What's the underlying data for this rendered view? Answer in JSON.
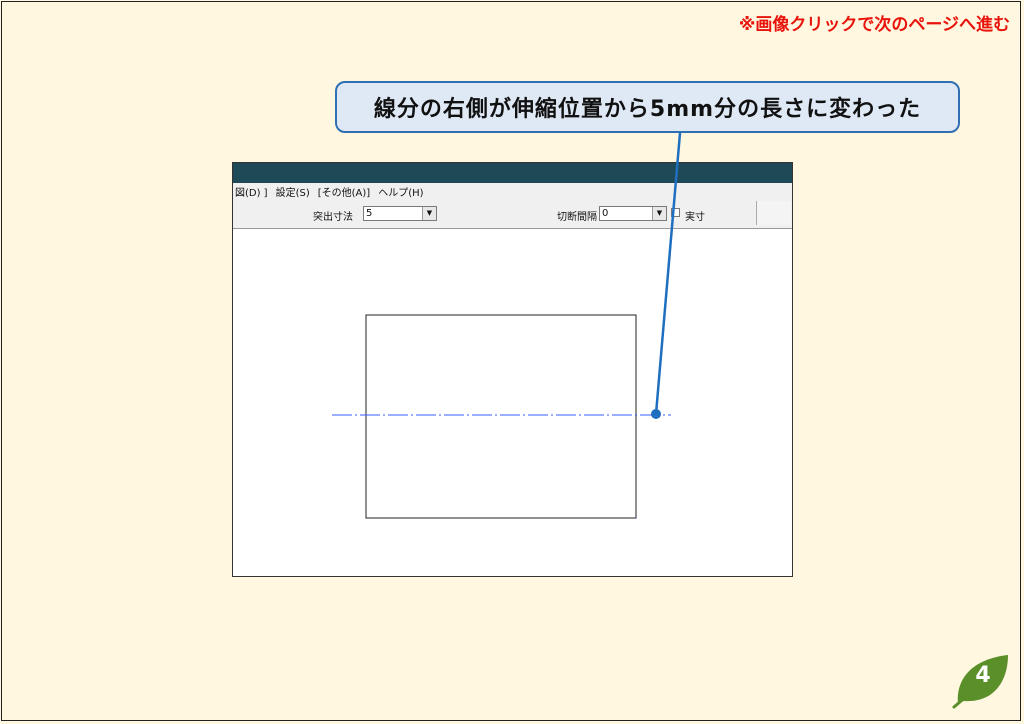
{
  "slide": {
    "nav_note": "※画像クリックで次のページへ進む",
    "callout_text": "線分の右側が伸縮位置から5mm分の長さに変わった",
    "page_number": "4"
  },
  "app": {
    "menu": [
      {
        "label": "図(D) ]"
      },
      {
        "label": "設定(S)"
      },
      {
        "label": "[その他(A)]"
      },
      {
        "label": "ヘルプ(H)"
      }
    ],
    "toolbar": {
      "protrude_label": "突出寸法",
      "protrude_value": "5",
      "cut_label": "切断間隔",
      "cut_value": "0",
      "actual_label": "実寸"
    }
  },
  "colors": {
    "background": "#fff7e0",
    "titlebar": "#1e4a58",
    "accent_blue": "#1f6fc0",
    "nav_red": "#e8140c",
    "leaf_green": "#5a8f2a",
    "centerline": "#3a5cff"
  },
  "icons": {
    "combo_arrow": "chevron-down-icon",
    "page_badge": "leaf-icon"
  }
}
